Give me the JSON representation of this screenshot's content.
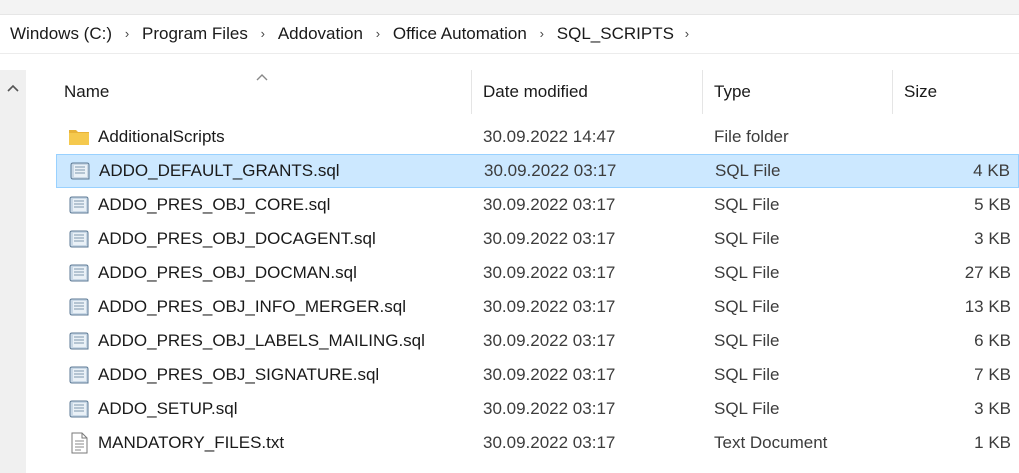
{
  "breadcrumb": {
    "items": [
      "Windows (C:)",
      "Program Files",
      "Addovation",
      "Office Automation",
      "SQL_SCRIPTS"
    ],
    "separator": "›"
  },
  "columns": {
    "name": "Name",
    "date": "Date modified",
    "type": "Type",
    "size": "Size"
  },
  "colors": {
    "selection_bg": "#cce8ff",
    "selection_border": "#99d1ff",
    "folder": "#f0c44a"
  },
  "files": [
    {
      "name": "AdditionalScripts",
      "date": "30.09.2022 14:47",
      "type": "File folder",
      "size": "",
      "icon": "folder-icon",
      "selected": false
    },
    {
      "name": "ADDO_DEFAULT_GRANTS.sql",
      "date": "30.09.2022 03:17",
      "type": "SQL File",
      "size": "4 KB",
      "icon": "sql-file-icon",
      "selected": true
    },
    {
      "name": "ADDO_PRES_OBJ_CORE.sql",
      "date": "30.09.2022 03:17",
      "type": "SQL File",
      "size": "5 KB",
      "icon": "sql-file-icon",
      "selected": false
    },
    {
      "name": "ADDO_PRES_OBJ_DOCAGENT.sql",
      "date": "30.09.2022 03:17",
      "type": "SQL File",
      "size": "3 KB",
      "icon": "sql-file-icon",
      "selected": false
    },
    {
      "name": "ADDO_PRES_OBJ_DOCMAN.sql",
      "date": "30.09.2022 03:17",
      "type": "SQL File",
      "size": "27 KB",
      "icon": "sql-file-icon",
      "selected": false
    },
    {
      "name": "ADDO_PRES_OBJ_INFO_MERGER.sql",
      "date": "30.09.2022 03:17",
      "type": "SQL File",
      "size": "13 KB",
      "icon": "sql-file-icon",
      "selected": false
    },
    {
      "name": "ADDO_PRES_OBJ_LABELS_MAILING.sql",
      "date": "30.09.2022 03:17",
      "type": "SQL File",
      "size": "6 KB",
      "icon": "sql-file-icon",
      "selected": false
    },
    {
      "name": "ADDO_PRES_OBJ_SIGNATURE.sql",
      "date": "30.09.2022 03:17",
      "type": "SQL File",
      "size": "7 KB",
      "icon": "sql-file-icon",
      "selected": false
    },
    {
      "name": "ADDO_SETUP.sql",
      "date": "30.09.2022 03:17",
      "type": "SQL File",
      "size": "3 KB",
      "icon": "sql-file-icon",
      "selected": false
    },
    {
      "name": "MANDATORY_FILES.txt",
      "date": "30.09.2022 03:17",
      "type": "Text Document",
      "size": "1 KB",
      "icon": "text-file-icon",
      "selected": false
    }
  ]
}
